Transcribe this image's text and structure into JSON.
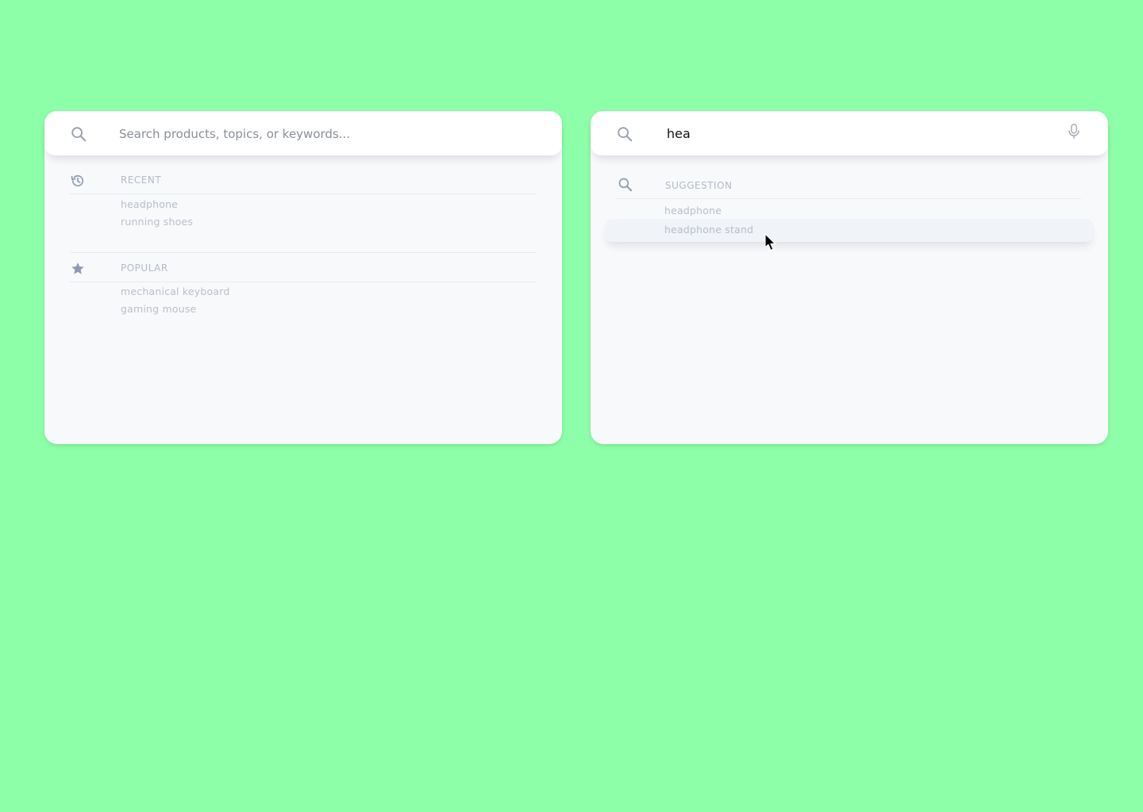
{
  "left_panel": {
    "search": {
      "value": "",
      "placeholder": "Search products, topics, or keywords..."
    },
    "recent": {
      "title": "RECENT",
      "icon": "history-icon",
      "items": [
        "headphone",
        "running shoes"
      ]
    },
    "popular": {
      "title": "POPULAR",
      "icon": "star-icon",
      "items": [
        "mechanical keyboard",
        "gaming mouse"
      ]
    }
  },
  "right_panel": {
    "search": {
      "value": "hea",
      "placeholder": ""
    },
    "mic_icon": "microphone-icon",
    "suggestion": {
      "title": "SUGGESTION",
      "icon": "search-suggestion-icon",
      "items": [
        "headphone",
        "headphone stand"
      ],
      "hovered_index": 1
    }
  },
  "colors": {
    "background": "#8effa9",
    "panel": "#f8f9fb",
    "search_bar": "#ffffff",
    "muted_text": "#b8bec8",
    "icon": "#9aa6b8"
  }
}
